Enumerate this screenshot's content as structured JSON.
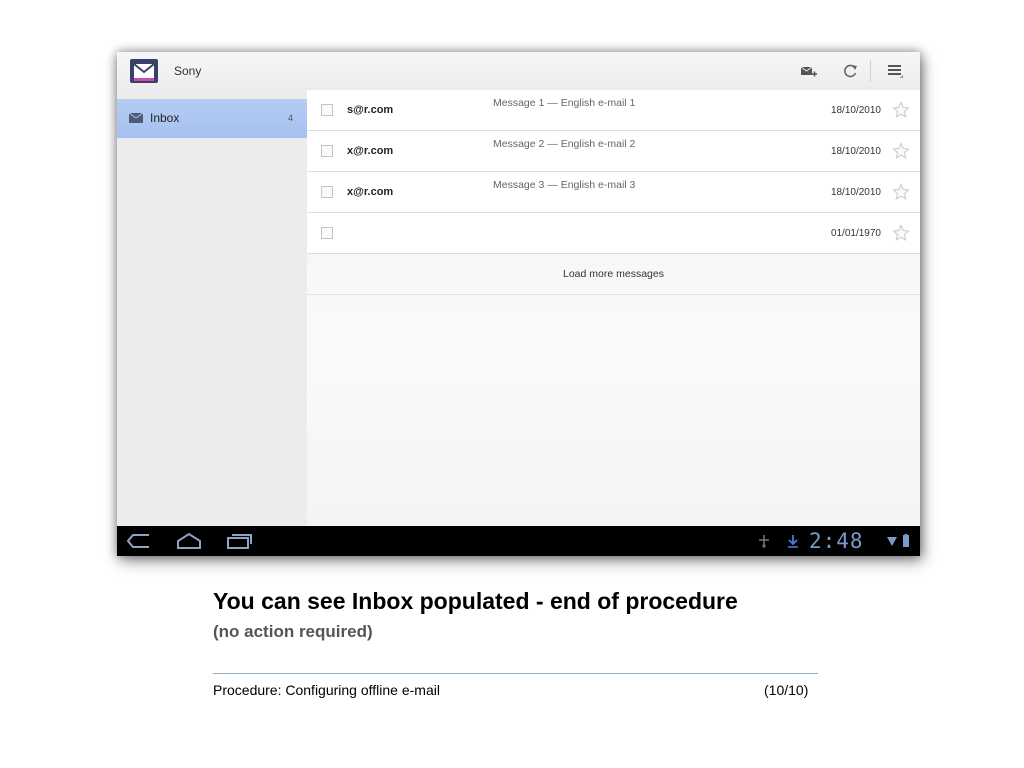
{
  "action_bar": {
    "account": "Sony",
    "icons": [
      "mail-app-icon",
      "compose-icon",
      "refresh-icon",
      "menu-icon"
    ]
  },
  "sidebar": {
    "items": [
      {
        "label": "Inbox",
        "count": "4",
        "icon": "inbox-icon",
        "selected": true
      }
    ]
  },
  "messages": [
    {
      "sender": "s@r.com",
      "subject": "Message 1 — English e-mail 1",
      "date": "18/10/2010"
    },
    {
      "sender": "x@r.com",
      "subject": "Message 2 — English e-mail 2",
      "date": "18/10/2010"
    },
    {
      "sender": "x@r.com",
      "subject": "Message 3 — English e-mail 3",
      "date": "18/10/2010"
    },
    {
      "sender": "",
      "subject": "",
      "date": "01/01/1970"
    }
  ],
  "list": {
    "load_more": "Load more messages"
  },
  "system_bar": {
    "time": "2:48",
    "icons": [
      "back-icon",
      "home-icon",
      "recent-apps-icon",
      "usb-icon",
      "download-icon",
      "signal-icon",
      "battery-icon"
    ]
  },
  "caption": {
    "title": "You can see Inbox populated - end of procedure",
    "subtitle": "(no action required)"
  },
  "footer": {
    "procedure": "Procedure: Configuring offline e-mail",
    "page": "(10/10)"
  },
  "colors": {
    "selected_folder": "#a6c1f0",
    "clock": "#7a9bc8",
    "footer_rule": "#8fb0c8"
  }
}
